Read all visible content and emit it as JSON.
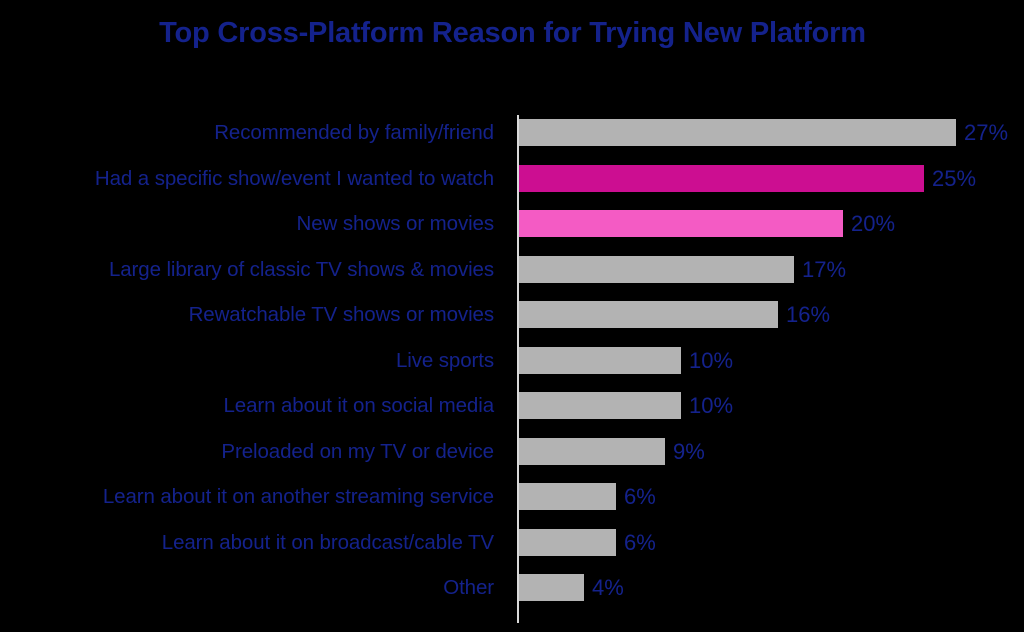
{
  "chart_data": {
    "type": "bar",
    "orientation": "horizontal",
    "title": "Top Cross-Platform Reason for Trying New Platform",
    "xlabel": "",
    "ylabel": "",
    "xlim": [
      0,
      27
    ],
    "grid": false,
    "legend": null,
    "value_suffix": "%",
    "categories": [
      "Recommended by family/friend",
      "Had a specific show/event I wanted to watch",
      "New shows or movies",
      "Large library of classic TV shows & movies",
      "Rewatchable TV shows or movies",
      "Live sports",
      "Learn about it on social media",
      "Preloaded on my TV or device",
      "Learn about it on another streaming service",
      "Learn about it on broadcast/cable TV",
      "Other"
    ],
    "values": [
      27,
      25,
      20,
      17,
      16,
      10,
      10,
      9,
      6,
      6,
      4
    ],
    "value_labels": [
      "27%",
      "25%",
      "20%",
      "17%",
      "16%",
      "10%",
      "10%",
      "9%",
      "6%",
      "6%",
      "4%"
    ],
    "bar_colors": [
      "#b3b3b3",
      "#cc0e91",
      "#f45bc4",
      "#b3b3b3",
      "#b3b3b3",
      "#b3b3b3",
      "#b3b3b3",
      "#b3b3b3",
      "#b3b3b3",
      "#b3b3b3",
      "#b3b3b3"
    ]
  },
  "colors": {
    "background": "#000000",
    "title_text": "#14228c",
    "label_text": "#14228c",
    "value_text": "#14228c",
    "bar_default": "#b3b3b3",
    "bar_highlight_dark": "#cc0e91",
    "bar_highlight_light": "#f45bc4",
    "axis_line": "#d9d9d9"
  }
}
